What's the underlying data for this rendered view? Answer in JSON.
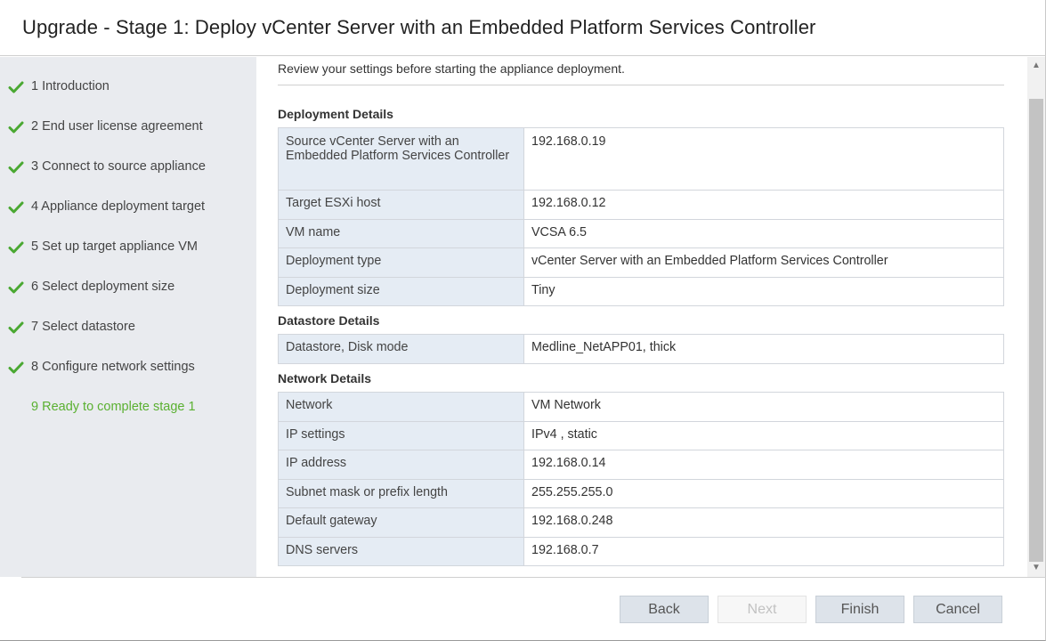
{
  "window": {
    "title": "Upgrade - Stage 1: Deploy vCenter Server with an Embedded Platform Services Controller"
  },
  "colors": {
    "accent_green": "#5ab031",
    "sidebar_bg": "#e9ebef",
    "key_cell_bg": "#e5ecf4"
  },
  "steps": [
    {
      "label": "1 Introduction",
      "done": true,
      "icon": "check-icon"
    },
    {
      "label": "2 End user license agreement",
      "done": true,
      "icon": "check-icon"
    },
    {
      "label": "3 Connect to source appliance",
      "done": true,
      "icon": "check-icon"
    },
    {
      "label": "4 Appliance deployment target",
      "done": true,
      "icon": "check-icon"
    },
    {
      "label": "5 Set up target appliance VM",
      "done": true,
      "icon": "check-icon"
    },
    {
      "label": "6 Select deployment size",
      "done": true,
      "icon": "check-icon"
    },
    {
      "label": "7 Select datastore",
      "done": true,
      "icon": "check-icon"
    },
    {
      "label": "8 Configure network settings",
      "done": true,
      "icon": "check-icon"
    },
    {
      "label": "9 Ready to complete stage 1",
      "done": false,
      "current": true
    }
  ],
  "content": {
    "intro": "Review your settings before starting the appliance deployment.",
    "sections": [
      {
        "title": "Deployment Details",
        "rows": [
          {
            "key": "Source vCenter Server with an Embedded Platform Services Controller",
            "value": "192.168.0.19"
          },
          {
            "key": "Target ESXi host",
            "value": "192.168.0.12"
          },
          {
            "key": "VM name",
            "value": "VCSA 6.5"
          },
          {
            "key": "Deployment type",
            "value": "vCenter Server with an Embedded Platform Services Controller"
          },
          {
            "key": "Deployment size",
            "value": "Tiny"
          }
        ]
      },
      {
        "title": "Datastore Details",
        "rows": [
          {
            "key": "Datastore, Disk mode",
            "value": "Medline_NetAPP01, thick"
          }
        ]
      },
      {
        "title": "Network Details",
        "rows": [
          {
            "key": "Network",
            "value": "VM Network"
          },
          {
            "key": "IP settings",
            "value": "IPv4 , static"
          },
          {
            "key": "IP address",
            "value": "192.168.0.14"
          },
          {
            "key": "Subnet mask or prefix length",
            "value": "255.255.255.0"
          },
          {
            "key": "Default gateway",
            "value": "192.168.0.248"
          },
          {
            "key": "DNS servers",
            "value": "192.168.0.7"
          }
        ]
      }
    ]
  },
  "buttons": {
    "back": {
      "label": "Back",
      "enabled": true
    },
    "next": {
      "label": "Next",
      "enabled": false
    },
    "finish": {
      "label": "Finish",
      "enabled": true
    },
    "cancel": {
      "label": "Cancel",
      "enabled": true
    }
  }
}
